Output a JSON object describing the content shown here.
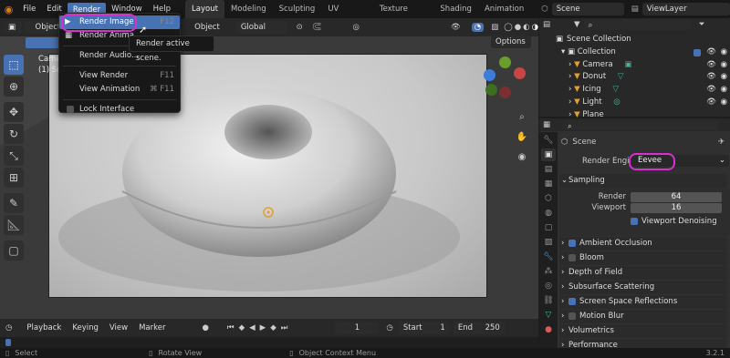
{
  "topbar": {
    "menus": [
      "File",
      "Edit",
      "Render",
      "Window",
      "Help"
    ],
    "workspaces": [
      "Layout",
      "Modeling",
      "Sculpting",
      "UV Editing",
      "Texture Paint",
      "Shading",
      "Animation"
    ],
    "scene": "Scene",
    "view_layer": "ViewLayer"
  },
  "vheader": {
    "mode": "Object",
    "object_menu": "Object",
    "orientation": "Global",
    "options": "Options"
  },
  "viewport": {
    "camera_text": "Came",
    "collection_text": "(1) Sc"
  },
  "render_menu": {
    "items": [
      {
        "label": "Render Image",
        "key": "F12"
      },
      {
        "label": "Render Anima",
        "key": ""
      },
      {
        "label": "Render Audio...",
        "key": ""
      },
      {
        "label": "View Render",
        "key": "F11"
      },
      {
        "label": "View Animation",
        "key": "⌘ F11"
      },
      {
        "label": "Lock Interface",
        "key": ""
      }
    ],
    "tooltip": "Render active scene."
  },
  "outliner": {
    "root": "Scene Collection",
    "collection": "Collection",
    "objects": [
      "Camera",
      "Donut",
      "Icing",
      "Light",
      "Plane"
    ]
  },
  "properties": {
    "context": "Scene",
    "render_engine_label": "Render Engine",
    "render_engine": "Eevee",
    "sampling": {
      "label": "Sampling",
      "render_label": "Render",
      "render": "64",
      "viewport_label": "Viewport",
      "viewport": "16",
      "denoise": "Viewport Denoising"
    },
    "panels": [
      {
        "label": "Ambient Occlusion",
        "check": true
      },
      {
        "label": "Bloom",
        "check": false
      },
      {
        "label": "Depth of Field",
        "check": null
      },
      {
        "label": "Subsurface Scattering",
        "check": null
      },
      {
        "label": "Screen Space Reflections",
        "check": true
      },
      {
        "label": "Motion Blur",
        "check": false
      },
      {
        "label": "Volumetrics",
        "check": null
      },
      {
        "label": "Performance",
        "check": null
      }
    ]
  },
  "timeline": {
    "playback": "Playback",
    "keying": "Keying",
    "view": "View",
    "marker": "Marker",
    "current_frame": "1",
    "start_label": "Start",
    "start": "1",
    "end_label": "End",
    "end": "250"
  },
  "status": {
    "select": "Select",
    "rotate": "Rotate View",
    "context": "Object Context Menu",
    "version": "3.2.1"
  },
  "colors": {
    "accent": "#4772b3",
    "highlight_circle": "#d82fd0"
  }
}
